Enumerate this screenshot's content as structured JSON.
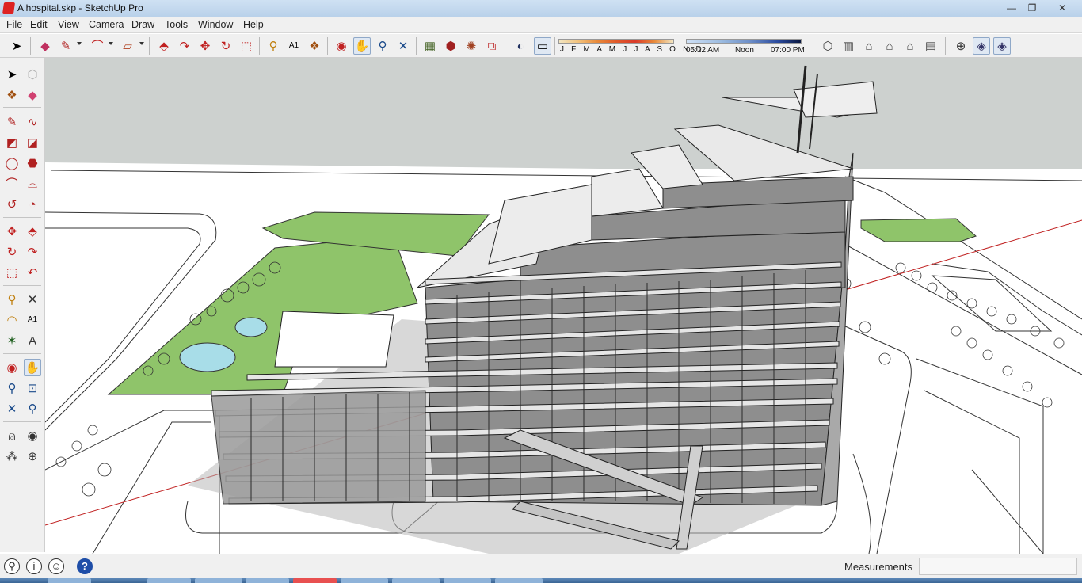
{
  "window": {
    "title": "A hospital.skp - SketchUp Pro",
    "controls": {
      "minimize": "—",
      "maximize": "❐",
      "close": "✕"
    }
  },
  "menu": {
    "items": [
      "File",
      "Edit",
      "View",
      "Camera",
      "Draw",
      "Tools",
      "Window",
      "Help"
    ]
  },
  "toolbar": {
    "shadow_months": "J F M A M J J A S O N D",
    "time_start": "05:12 AM",
    "time_noon": "Noon",
    "time_end": "07:00 PM"
  },
  "icons": {
    "select": "select-arrow-icon",
    "eraser": "eraser-icon",
    "pencil": "pencil-icon",
    "arc": "arc-icon",
    "rectangle": "rectangle-icon",
    "pushpull": "push-pull-icon",
    "follow_me": "follow-me-icon",
    "move": "move-icon",
    "rotate": "rotate-icon",
    "scale": "scale-icon",
    "tape": "tape-measure-icon",
    "text": "text-icon",
    "paint": "paint-bucket-icon",
    "orbit": "orbit-icon",
    "pan": "pan-hand-icon",
    "zoom": "zoom-icon",
    "zoom_extents": "zoom-extents-icon",
    "components": "components-icon",
    "warehouse": "warehouse-icon",
    "share": "share-model-icon",
    "layers": "layers-icon",
    "shadows": "shadows-icon",
    "fog": "fog-icon",
    "iso": "iso-view-icon",
    "top": "top-view-icon",
    "front": "front-view-icon",
    "right": "right-view-icon",
    "back": "back-view-icon",
    "left": "left-view-icon",
    "section": "section-plane-icon",
    "xray": "xray-icon",
    "walk": "walk-icon",
    "look_around": "look-around-icon",
    "footprints": "footprints-icon",
    "position_camera": "position-camera-icon"
  },
  "status": {
    "measurements_label": "Measurements",
    "measurements_value": "",
    "help_glyph": "?",
    "info_glyph": "i"
  },
  "colors": {
    "sky": "#cdd1cf",
    "ground": "#ffffff",
    "grass": "#8fc46a",
    "water": "#a8dde8",
    "building_face": "#8e8e8e",
    "building_light": "#e9e9e9",
    "red_axis": "#c02020",
    "title_bar": "#cfe1f3",
    "active_tool": "#dfe8f3"
  }
}
